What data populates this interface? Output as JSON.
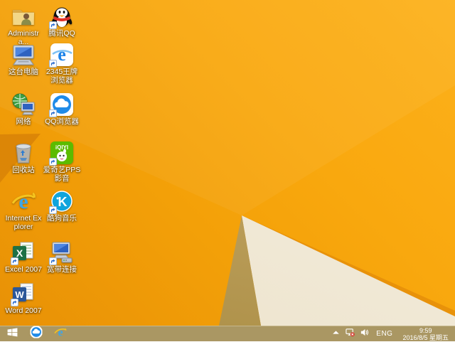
{
  "wallpaper": {
    "name": "windows-8-orange-default",
    "base_color": "#F8A60C",
    "bright_color": "#FCB11C",
    "dark_left_color": "#E18A08",
    "cream_facet_color": "#F0E8D5",
    "khaki_facet_color": "#BC9F5C",
    "edge_strip_color": "#E8920A"
  },
  "desktop": {
    "icons": [
      {
        "label": "Administra...",
        "icon": "user-folder",
        "col": 0,
        "row": 0,
        "shortcut": false
      },
      {
        "label": "腾讯QQ",
        "icon": "qq",
        "col": 1,
        "row": 0,
        "shortcut": true
      },
      {
        "label": "这台电脑",
        "icon": "computer",
        "col": 0,
        "row": 1,
        "shortcut": false
      },
      {
        "label": "2345王牌浏览器",
        "icon": "browser-2345",
        "col": 1,
        "row": 1,
        "shortcut": true
      },
      {
        "label": "网络",
        "icon": "network",
        "col": 0,
        "row": 2,
        "shortcut": false
      },
      {
        "label": "QQ浏览器",
        "icon": "qq-browser",
        "col": 1,
        "row": 2,
        "shortcut": true
      },
      {
        "label": "回收站",
        "icon": "recycle-bin",
        "col": 0,
        "row": 3,
        "shortcut": false
      },
      {
        "label": "爱奇艺PPS 影音",
        "icon": "iqiyi-pps",
        "col": 1,
        "row": 3,
        "shortcut": true
      },
      {
        "label": "Internet Explorer",
        "icon": "ie",
        "col": 0,
        "row": 4,
        "shortcut": false
      },
      {
        "label": "酷狗音乐",
        "icon": "kugou",
        "col": 1,
        "row": 4,
        "shortcut": true
      },
      {
        "label": "Excel 2007",
        "icon": "excel",
        "col": 0,
        "row": 5,
        "shortcut": true
      },
      {
        "label": "宽带连接",
        "icon": "broadband",
        "col": 1,
        "row": 5,
        "shortcut": true
      },
      {
        "label": "Word 2007",
        "icon": "word",
        "col": 0,
        "row": 6,
        "shortcut": true
      }
    ]
  },
  "taskbar": {
    "start_button": {
      "icon": "windows-logo",
      "tooltip": "Start"
    },
    "pinned": [
      {
        "icon": "qq-browser",
        "label": "QQ浏览器"
      },
      {
        "icon": "ie",
        "label": "Internet Explorer"
      }
    ],
    "tray": {
      "icons": [
        {
          "icon": "chevron-up",
          "label": "Show hidden icons"
        },
        {
          "icon": "network-error",
          "label": "Network - no connection"
        },
        {
          "icon": "speaker",
          "label": "Volume"
        }
      ],
      "language": "ENG",
      "time": "9:59",
      "date": "2016/8/5 星期五"
    }
  }
}
